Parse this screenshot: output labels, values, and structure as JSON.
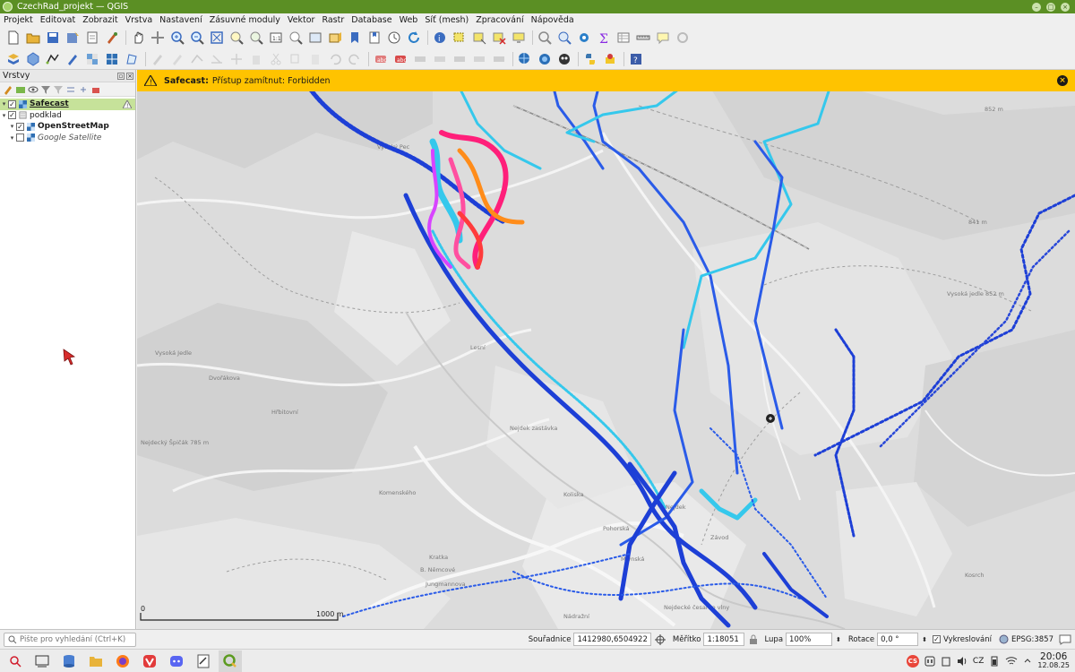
{
  "window": {
    "title": "CzechRad_projekt — QGIS"
  },
  "menu": [
    "Projekt",
    "Editovat",
    "Zobrazit",
    "Vrstva",
    "Nastavení",
    "Zásuvné moduly",
    "Vektor",
    "Rastr",
    "Database",
    "Web",
    "Síť (mesh)",
    "Zpracování",
    "Nápověda"
  ],
  "layers_panel": {
    "title": "Vrstvy",
    "items": [
      {
        "label": "Safecast",
        "checked": true,
        "selected": true,
        "bold": true,
        "warning": true
      },
      {
        "label": "podklad",
        "checked": true,
        "group": true
      },
      {
        "label": "OpenStreetMap",
        "checked": true,
        "bold": true
      },
      {
        "label": "Google Satellite",
        "checked": false,
        "italic": true
      }
    ]
  },
  "banner": {
    "title": "Safecast:",
    "message": "Přístup zamítnut: Forbidden",
    "color": "#ffc300"
  },
  "map": {
    "labels": [
      "Vysoký Pec",
      "Vysoká Jedle",
      "Nejdek",
      "Nejdecký Špičák 785 m",
      "852 m",
      "841 m",
      "Vysoká jedle 852 m",
      "Nejdek zastávka",
      "Nejdecké česarno vlny",
      "Koliska",
      "Komenského",
      "Kratka",
      "Jungmannova",
      "Nádražní",
      "Mlýnská",
      "Kosrch",
      "Pohorská",
      "B. Němcové",
      "Lesní",
      "Závod",
      "Hřbitovní",
      "Dvořákova"
    ],
    "scale_bar_zero": "0",
    "scale_bar_label": "1000 m"
  },
  "statusbar": {
    "search_placeholder": "Pište pro vyhledání (Ctrl+K)",
    "coordinates_label": "Souřadnice",
    "coordinates": "1412980,6504922",
    "scale_label": "Měřítko",
    "scale": "1:18051",
    "magnifier_label": "Lupa",
    "magnifier": "100%",
    "rotation_label": "Rotace",
    "rotation": "0,0 °",
    "render_label": "Vykreslování",
    "render_checked": true,
    "crs": "EPSG:3857"
  },
  "taskbar": {
    "lang": "CS",
    "kbd": "CZ",
    "time": "20:06",
    "date": "12.08.25"
  },
  "colors": {
    "titlebar": "#5b8f24",
    "selected_layer": "#c6e29a",
    "track_low": "#1d3fd6",
    "track_mid": "#35c8ec",
    "track_high": "#ff1f7a"
  }
}
